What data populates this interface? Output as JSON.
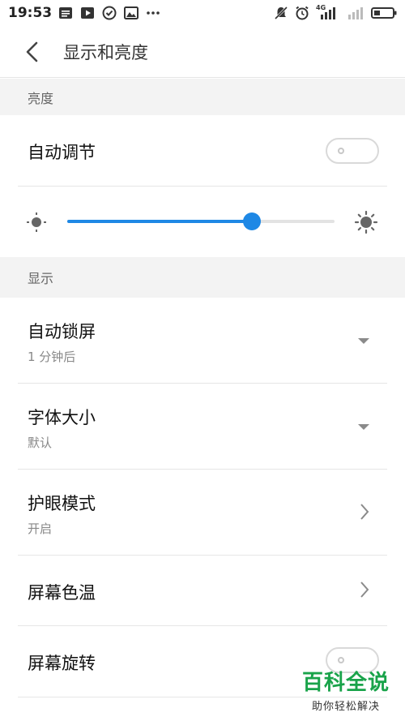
{
  "status_bar": {
    "time": "19:53",
    "left_icons": [
      "message-icon",
      "video-icon",
      "check-circle-icon",
      "image-icon",
      "more-dots-icon"
    ],
    "network_label": "4G"
  },
  "header": {
    "title": "显示和亮度"
  },
  "sections": {
    "brightness": {
      "label": "亮度"
    },
    "display": {
      "label": "显示"
    }
  },
  "auto_adjust": {
    "label": "自动调节",
    "enabled": false
  },
  "brightness_slider": {
    "value": 0.69
  },
  "auto_lock": {
    "label": "自动锁屏",
    "value": "1 分钟后"
  },
  "font_size": {
    "label": "字体大小",
    "value": "默认"
  },
  "eye_care": {
    "label": "护眼模式",
    "value": "开启"
  },
  "color_temp": {
    "label": "屏幕色温"
  },
  "rotation": {
    "label": "屏幕旋转",
    "enabled": false
  },
  "watermark": {
    "title": "百科全说",
    "subtitle": "助你轻松解决"
  },
  "colors": {
    "accent": "#1e88e5",
    "section_bg": "#f3f3f3",
    "watermark_green": "#19a34a"
  }
}
